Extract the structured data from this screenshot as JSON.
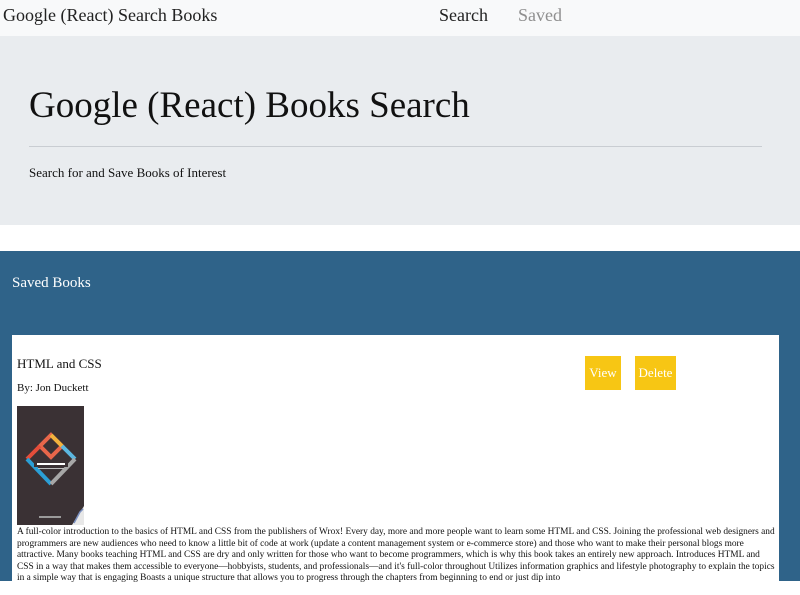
{
  "navbar": {
    "brand": "Google (React) Search Books",
    "links": [
      {
        "label": "Search",
        "active": true
      },
      {
        "label": "Saved",
        "active": false
      }
    ]
  },
  "jumbotron": {
    "title": "Google (React) Books Search",
    "lead": "Search for and Save Books of Interest"
  },
  "saved": {
    "title": "Saved Books",
    "books": [
      {
        "title": "HTML and CSS",
        "author": "By: Jon Duckett",
        "view_label": "View",
        "delete_label": "Delete",
        "description": "A full-color introduction to the basics of HTML and CSS from the publishers of Wrox! Every day, more and more people want to learn some HTML and CSS. Joining the professional web designers and programmers are new audiences who need to know a little bit of code at work (update a content management system or e-commerce store) and those who want to make their personal blogs more attractive. Many books teaching HTML and CSS are dry and only written for those who want to become programmers, which is why this book takes an entirely new approach. Introduces HTML and CSS in a way that makes them accessible to everyone—hobbyists, students, and professionals—and it's full-color throughout Utilizes information graphics and lifestyle photography to explain the topics in a simple way that is engaging Boasts a unique structure that allows you to progress through the chapters from beginning to end or just dip into"
      }
    ]
  },
  "colors": {
    "navbar_bg": "#f8f9fa",
    "jumbotron_bg": "#e9ecef",
    "panel_bg": "#2f6389",
    "button_bg": "#f7c614"
  }
}
